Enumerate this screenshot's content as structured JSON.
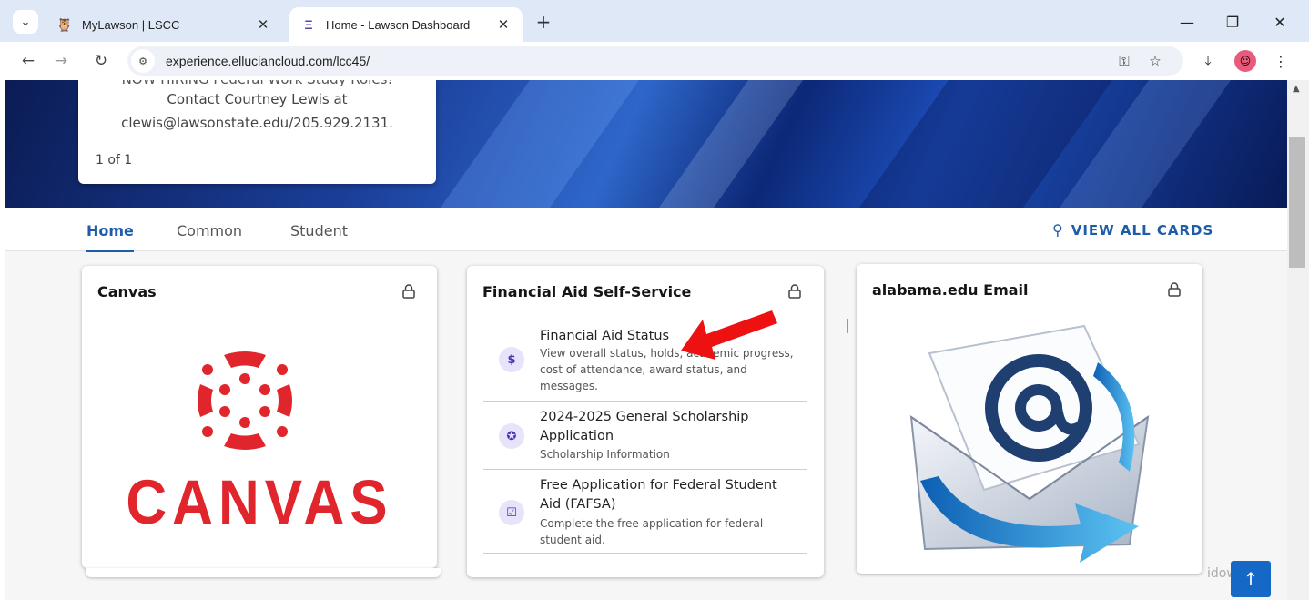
{
  "browser": {
    "tabs": [
      {
        "title": "MyLawson | LSCC",
        "close": "✕"
      },
      {
        "title": "Home - Lawson Dashboard",
        "close": "✕"
      }
    ],
    "new_tab": "+",
    "url": "experience.elluciancloud.com/lcc45/",
    "window_controls": {
      "minimize": "—",
      "restore": "❐",
      "close": "✕"
    }
  },
  "announcement": {
    "clipped_line": "NOW HIRING Federal Work Study Roles!",
    "line1": "Contact Courtney Lewis at",
    "line2": "clewis@lawsonstate.edu/205.929.2131.",
    "pager": "1 of 1"
  },
  "nav": {
    "tabs": [
      "Home",
      "Common",
      "Student"
    ],
    "active": "Home",
    "view_all": "VIEW ALL CARDS"
  },
  "cards": {
    "canvas": {
      "title": "Canvas",
      "logo_text": "CANVAS"
    },
    "financial_aid": {
      "title": "Financial Aid Self-Service",
      "items": [
        {
          "title": "Financial Aid Status",
          "description": "View overall status, holds, academic progress, cost of attendance, award status, and messages.",
          "icon": "dollar-icon"
        },
        {
          "title": "2024-2025 General Scholarship Application",
          "description": "Scholarship Information",
          "icon": "award-icon"
        },
        {
          "title": "Free Application for Federal Student Aid (FAFSA)",
          "description": "Complete the free application for federal student aid.",
          "icon": "clipboard-check-icon"
        }
      ]
    },
    "email": {
      "title": "alabama.edu Email"
    }
  },
  "watermark": "idows",
  "colors": {
    "accent": "#1c5ca8",
    "canvas_red": "#e0262c",
    "fa_icon_bg": "#e6e3fb",
    "arrow_red": "#ee1111"
  }
}
